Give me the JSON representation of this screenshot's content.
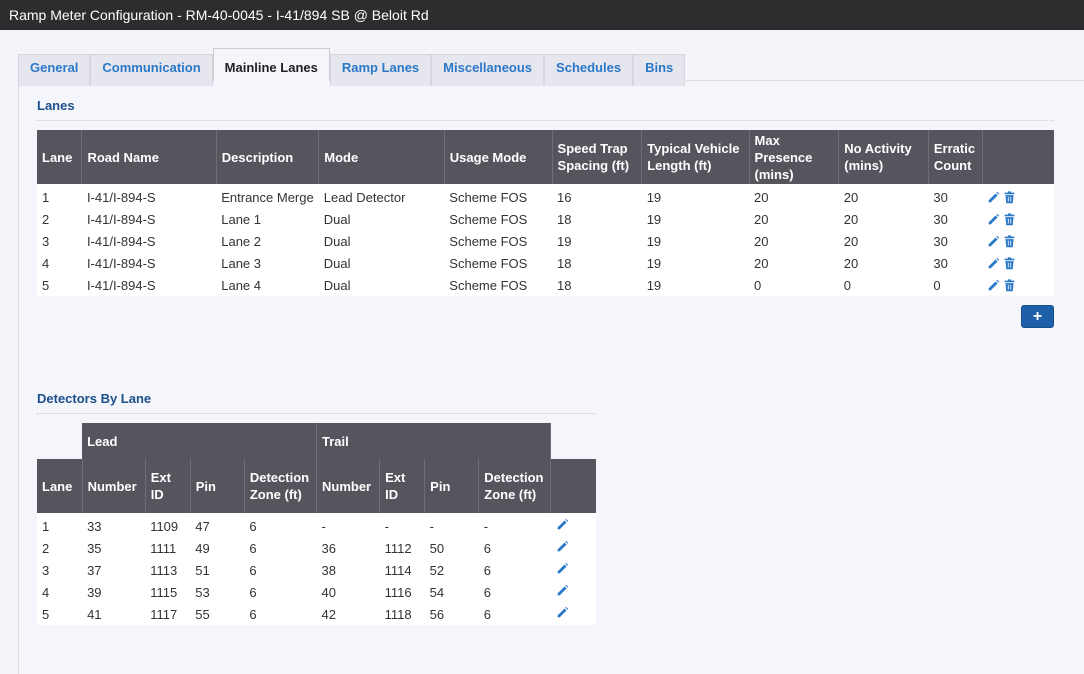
{
  "window": {
    "title": "Ramp Meter Configuration - RM-40-0045 - I-41/894 SB @ Beloit Rd"
  },
  "tabs": [
    {
      "label": "General",
      "active": false
    },
    {
      "label": "Communication",
      "active": false
    },
    {
      "label": "Mainline Lanes",
      "active": true
    },
    {
      "label": "Ramp Lanes",
      "active": false
    },
    {
      "label": "Miscellaneous",
      "active": false
    },
    {
      "label": "Schedules",
      "active": false
    },
    {
      "label": "Bins",
      "active": false
    }
  ],
  "lanes": {
    "title": "Lanes",
    "columns": {
      "lane": "Lane",
      "road_name": "Road Name",
      "description": "Description",
      "mode": "Mode",
      "usage_mode": "Usage Mode",
      "speed_trap_1": "Speed Trap",
      "speed_trap_2": "Spacing (ft)",
      "vehicle_len_1": "Typical Vehicle",
      "vehicle_len_2": "Length (ft)",
      "max_presence_1": "Max Presence",
      "max_presence_2": "(mins)",
      "no_activity_1": "No Activity",
      "no_activity_2": "(mins)",
      "erratic_1": "Erratic",
      "erratic_2": "Count"
    },
    "rows": [
      {
        "lane": "1",
        "road_name": "I-41/I-894-S",
        "description": "Entrance Merge",
        "mode": "Lead Detector",
        "usage_mode": "Scheme FOS",
        "speed_trap": "16",
        "vehicle_length": "19",
        "max_presence": "20",
        "no_activity": "20",
        "erratic": "30"
      },
      {
        "lane": "2",
        "road_name": "I-41/I-894-S",
        "description": "Lane 1",
        "mode": "Dual",
        "usage_mode": "Scheme FOS",
        "speed_trap": "18",
        "vehicle_length": "19",
        "max_presence": "20",
        "no_activity": "20",
        "erratic": "30"
      },
      {
        "lane": "3",
        "road_name": "I-41/I-894-S",
        "description": "Lane 2",
        "mode": "Dual",
        "usage_mode": "Scheme FOS",
        "speed_trap": "19",
        "vehicle_length": "19",
        "max_presence": "20",
        "no_activity": "20",
        "erratic": "30"
      },
      {
        "lane": "4",
        "road_name": "I-41/I-894-S",
        "description": "Lane 3",
        "mode": "Dual",
        "usage_mode": "Scheme FOS",
        "speed_trap": "18",
        "vehicle_length": "19",
        "max_presence": "20",
        "no_activity": "20",
        "erratic": "30"
      },
      {
        "lane": "5",
        "road_name": "I-41/I-894-S",
        "description": "Lane 4",
        "mode": "Dual",
        "usage_mode": "Scheme FOS",
        "speed_trap": "18",
        "vehicle_length": "19",
        "max_presence": "0",
        "no_activity": "0",
        "erratic": "0"
      }
    ],
    "add_label": "+"
  },
  "detectors": {
    "title": "Detectors By Lane",
    "group_lead": "Lead",
    "group_trail": "Trail",
    "columns": {
      "lane": "Lane",
      "number": "Number",
      "ext_id": "Ext ID",
      "pin": "Pin",
      "zone_1": "Detection",
      "zone_2": "Zone (ft)"
    },
    "rows": [
      {
        "lane": "1",
        "lead_number": "33",
        "lead_ext": "1109",
        "lead_pin": "47",
        "lead_zone": "6",
        "trail_number": "-",
        "trail_ext": "-",
        "trail_pin": "-",
        "trail_zone": "-"
      },
      {
        "lane": "2",
        "lead_number": "35",
        "lead_ext": "1111",
        "lead_pin": "49",
        "lead_zone": "6",
        "trail_number": "36",
        "trail_ext": "1112",
        "trail_pin": "50",
        "trail_zone": "6"
      },
      {
        "lane": "3",
        "lead_number": "37",
        "lead_ext": "1113",
        "lead_pin": "51",
        "lead_zone": "6",
        "trail_number": "38",
        "trail_ext": "1114",
        "trail_pin": "52",
        "trail_zone": "6"
      },
      {
        "lane": "4",
        "lead_number": "39",
        "lead_ext": "1115",
        "lead_pin": "53",
        "lead_zone": "6",
        "trail_number": "40",
        "trail_ext": "1116",
        "trail_pin": "54",
        "trail_zone": "6"
      },
      {
        "lane": "5",
        "lead_number": "41",
        "lead_ext": "1117",
        "lead_pin": "55",
        "lead_zone": "6",
        "trail_number": "42",
        "trail_ext": "1118",
        "trail_pin": "56",
        "trail_zone": "6"
      }
    ]
  },
  "icons": {
    "edit": "pencil-icon",
    "delete": "trash-icon",
    "add": "plus-icon"
  },
  "colors": {
    "accent": "#2b78c8",
    "header_bg": "#55565d",
    "button": "#1d5fa8",
    "titlebar": "#2d2d30"
  }
}
